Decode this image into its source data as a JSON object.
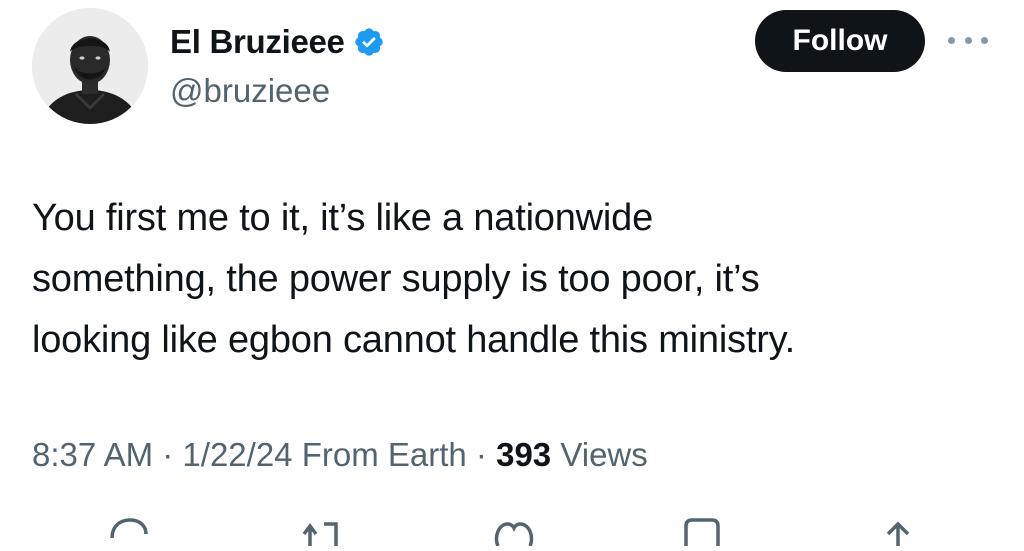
{
  "user": {
    "display_name": "El Bruzieee",
    "handle": "@bruzieee",
    "verified": true
  },
  "follow_button": {
    "label": "Follow"
  },
  "tweet": {
    "text": "You first me to it, it’s like a nationwide\nsomething, the power supply is too poor, it’s\nlooking like egbon cannot handle this ministry.",
    "time": "8:37 AM",
    "separator": "·",
    "date": "1/22/24",
    "source": "From Earth",
    "views_count": "393",
    "views_label": "Views"
  },
  "actions": [
    {
      "icon": "reply-icon"
    },
    {
      "icon": "retweet-icon"
    },
    {
      "icon": "like-icon"
    },
    {
      "icon": "bookmark-icon"
    },
    {
      "icon": "share-icon"
    }
  ],
  "colors": {
    "text_primary": "#0f1419",
    "text_secondary": "#536471",
    "verified_blue": "#1d9bf0",
    "follow_bg": "#0f1419",
    "follow_text": "#ffffff"
  }
}
